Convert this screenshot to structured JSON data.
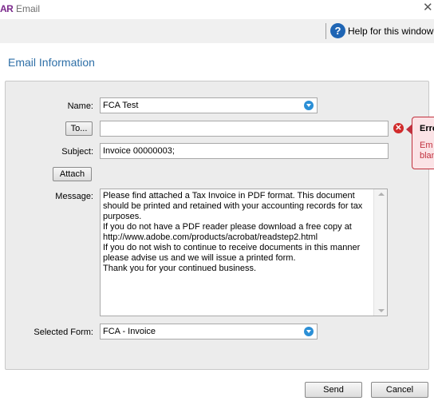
{
  "window": {
    "app_logo": "AR",
    "title": "Email",
    "close_glyph": "✕"
  },
  "toolbar": {
    "help_icon_glyph": "?",
    "help_label": "Help for this window"
  },
  "section_title": "Email Information",
  "form": {
    "name": {
      "label": "Name:",
      "value": "FCA Test"
    },
    "to": {
      "button_label": "To...",
      "value": ""
    },
    "subject": {
      "label": "Subject:",
      "value": "Invoice 00000003;"
    },
    "attach_label": "Attach",
    "message": {
      "label": "Message:",
      "value": "Please find attached a Tax Invoice in PDF format. This document should be printed and retained with your accounting records for tax purposes.\nIf you do not have a PDF reader please download a free copy at http://www.adobe.com/products/acrobat/readstep2.html\nIf you do not wish to continue to receive documents in this manner please advise us and we will issue a printed form.\nThank you for your continued business."
    },
    "selected_form": {
      "label": "Selected Form:",
      "value": "FCA - Invoice"
    }
  },
  "error_tip": {
    "icon_glyph": "✕",
    "title": "Erro",
    "message": "Em\nblan"
  },
  "footer": {
    "send_label": "Send",
    "cancel_label": "Cancel"
  },
  "colors": {
    "accent_title": "#2e6fa7",
    "help_icon": "#1f65b4",
    "dropdown_icon": "#2b8fd6",
    "error": "#d12b2b"
  },
  "icons": {
    "help": "help-icon",
    "dropdown": "chevron-down-icon",
    "error": "error-icon",
    "close": "close-icon"
  }
}
